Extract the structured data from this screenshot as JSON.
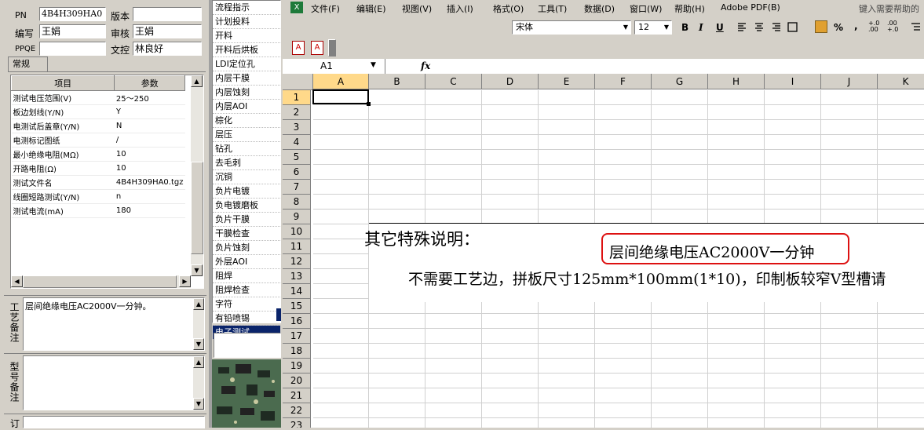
{
  "form": {
    "pn_label": "PN",
    "pn_value": "4B4H309HA0",
    "version_label": "版本",
    "version_value": "",
    "writer_label": "编写",
    "writer_value": "王娟",
    "reviewer_label": "审核",
    "reviewer_value": "王娟",
    "ppqe_label": "PPQE",
    "ppqe_value": "",
    "doc_control_label": "文控",
    "doc_control_value": "林良好"
  },
  "tabs": {
    "general": "常规"
  },
  "params": {
    "header_item": "项目",
    "header_value": "参数",
    "rows": [
      {
        "item": "测试电压范围(V)",
        "value": "25～250"
      },
      {
        "item": "板边划线(Y/N)",
        "value": "Y"
      },
      {
        "item": "电测试后盖章(Y/N)",
        "value": "N"
      },
      {
        "item": "电测标记图纸",
        "value": "/"
      },
      {
        "item": "最小绝缘电阻(MΩ)",
        "value": "10"
      },
      {
        "item": "开路电阻(Ω)",
        "value": "10"
      },
      {
        "item": "测试文件名",
        "value": "4B4H309HA0.tgz"
      },
      {
        "item": "线圈短路测试(Y/N)",
        "value": "n"
      },
      {
        "item": "测试电流(mA)",
        "value": "180"
      }
    ]
  },
  "notes": {
    "process_label": "工艺备注",
    "process_text": "层间绝缘电压AC2000V一分钟。",
    "model_label": "型号备注",
    "order_label": "订"
  },
  "process_list": [
    "流程指示",
    "计划投料",
    "开料",
    "开料后烘板",
    "LDI定位孔",
    "内层干膜",
    "内层蚀刻",
    "内层AOI",
    "棕化",
    "层压",
    "钻孔",
    "去毛刺",
    "沉铜",
    "负片电镀",
    "负电镀磨板",
    "负片干膜",
    "干膜检查",
    "负片蚀刻",
    "外层AOI",
    "阻焊",
    "阻焊检查",
    "字符",
    "有铅喷锡",
    "电子测试"
  ],
  "process_selected": "电子测试",
  "excel": {
    "menu": [
      "文件(F)",
      "编辑(E)",
      "视图(V)",
      "插入(I)",
      "格式(O)",
      "工具(T)",
      "数据(D)",
      "窗口(W)",
      "帮助(H)",
      "Adobe PDF(B)"
    ],
    "help_search": "键入需要帮助的",
    "font_name": "宋体",
    "font_size": "12",
    "bold": "B",
    "italic": "I",
    "underline": "U",
    "percent": "%",
    "comma": ",",
    "inc_decimal": "+.0\n.00",
    "dec_decimal": ".00\n+.0",
    "fx_label": "fx",
    "name_box": "A1",
    "columns": [
      "A",
      "B",
      "C",
      "D",
      "E",
      "F",
      "G",
      "H",
      "I",
      "J",
      "K"
    ],
    "rows": [
      "1",
      "2",
      "3",
      "4",
      "5",
      "6",
      "7",
      "8",
      "9",
      "10",
      "11",
      "12",
      "13",
      "14",
      "15",
      "16",
      "17",
      "18",
      "19",
      "20",
      "21",
      "22",
      "23"
    ],
    "pasted_title": "其它特殊说明：",
    "pasted_highlight": "层间绝缘电压AC2000V一分钟",
    "pasted_line2": "不需要工艺边，拼板尺寸125mm*100mm(1*10)，印制板较窄V型槽请"
  }
}
